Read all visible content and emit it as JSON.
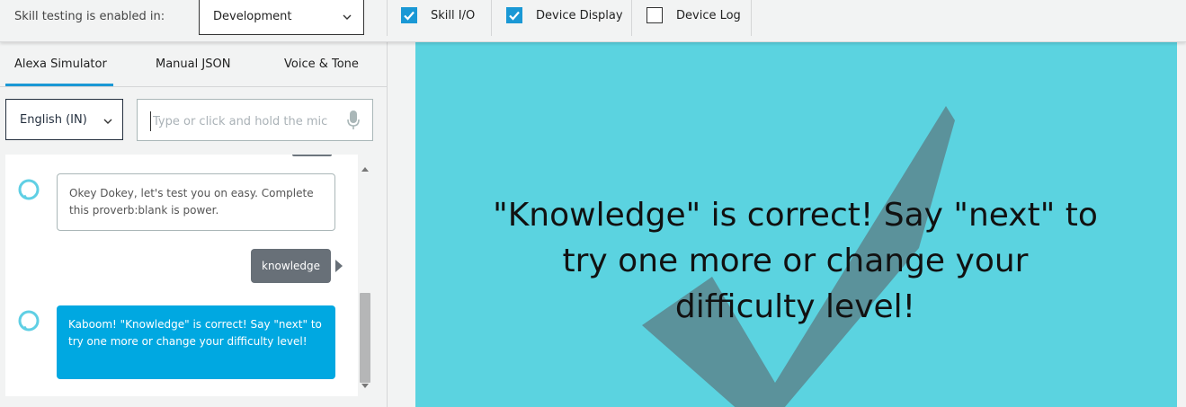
{
  "topbar": {
    "enabled_label": "Skill testing is enabled in:",
    "environment": "Development",
    "checkboxes": [
      {
        "label": "Skill I/O",
        "checked": true
      },
      {
        "label": "Device Display",
        "checked": true
      },
      {
        "label": "Device Log",
        "checked": false
      }
    ]
  },
  "tabs": [
    {
      "label": "Alexa Simulator",
      "active": true
    },
    {
      "label": "Manual JSON",
      "active": false
    },
    {
      "label": "Voice & Tone",
      "active": false
    }
  ],
  "simulator": {
    "locale": "English (IN)",
    "utterance_placeholder": "Type or click and hold the mic",
    "utterance_value": ""
  },
  "conversation": [
    {
      "speaker": "alexa",
      "text": "Okey Dokey, let's test you on easy. Complete this proverb:blank is power."
    },
    {
      "speaker": "user",
      "text": "knowledge"
    },
    {
      "speaker": "alexa",
      "text": "Kaboom! \"Knowledge\" is correct! Say \"next\" to try one more or change your difficulty level!"
    }
  ],
  "device_display": {
    "message": "\"Knowledge\" is correct! Say \"next\" to try one more or change your difficulty level!",
    "background_color": "#5bd3e0",
    "watermark_icon": "checkmark-icon"
  },
  "colors": {
    "accent": "#1a98d5",
    "alexa_bubble_highlight": "#00a8e1",
    "user_bubble": "#687078"
  }
}
